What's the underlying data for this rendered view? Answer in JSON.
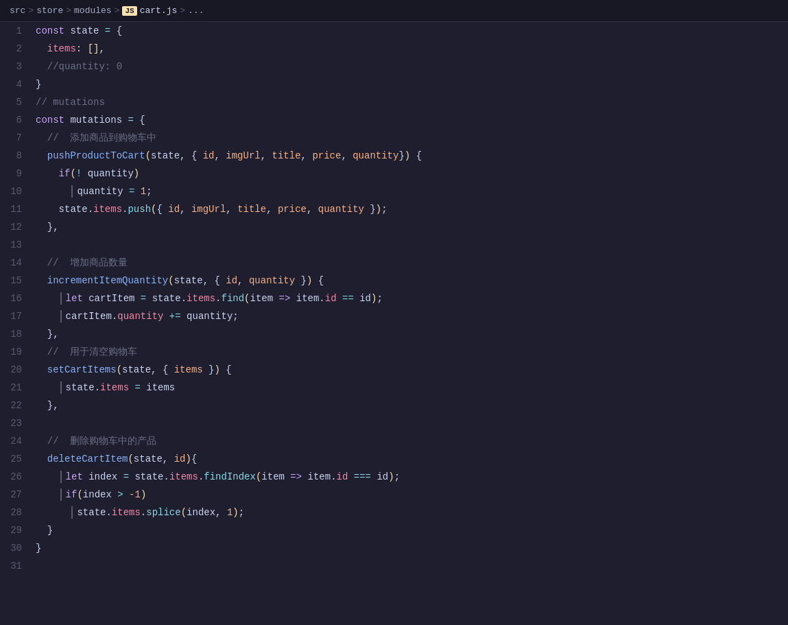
{
  "breadcrumb": {
    "src": "src",
    "sep1": ">",
    "store": "store",
    "sep2": ">",
    "modules": "modules",
    "sep3": ">",
    "js_badge": "JS",
    "filename": "cart.js",
    "sep4": ">",
    "ellipsis": "..."
  },
  "lines": [
    {
      "num": 1,
      "tokens": [
        {
          "t": "kw",
          "v": "const "
        },
        {
          "t": "ident",
          "v": "state "
        },
        {
          "t": "op",
          "v": "= "
        },
        {
          "t": "brace",
          "v": "{"
        }
      ]
    },
    {
      "num": 2,
      "tokens": [
        {
          "t": "indent",
          "v": "  "
        },
        {
          "t": "prop",
          "v": "items"
        },
        {
          "t": "punct",
          "v": ": "
        },
        {
          "t": "bracket",
          "v": "[]"
        },
        {
          "t": "punct",
          "v": ","
        }
      ]
    },
    {
      "num": 3,
      "tokens": [
        {
          "t": "indent",
          "v": "  "
        },
        {
          "t": "comment",
          "v": "//quantity: 0"
        }
      ]
    },
    {
      "num": 4,
      "tokens": [
        {
          "t": "brace",
          "v": "}"
        }
      ]
    },
    {
      "num": 5,
      "tokens": [
        {
          "t": "comment",
          "v": "// mutations"
        }
      ]
    },
    {
      "num": 6,
      "tokens": [
        {
          "t": "kw",
          "v": "const "
        },
        {
          "t": "ident",
          "v": "mutations "
        },
        {
          "t": "op",
          "v": "= "
        },
        {
          "t": "brace",
          "v": "{"
        }
      ]
    },
    {
      "num": 7,
      "tokens": [
        {
          "t": "indent",
          "v": "  "
        },
        {
          "t": "comment",
          "v": "//  添加商品到购物车中"
        }
      ]
    },
    {
      "num": 8,
      "tokens": [
        {
          "t": "indent",
          "v": "  "
        },
        {
          "t": "fn-name",
          "v": "pushProductToCart"
        },
        {
          "t": "paren",
          "v": "("
        },
        {
          "t": "ident",
          "v": "state"
        },
        {
          "t": "punct",
          "v": ", "
        },
        {
          "t": "brace",
          "v": "{ "
        },
        {
          "t": "param",
          "v": "id"
        },
        {
          "t": "punct",
          "v": ", "
        },
        {
          "t": "param",
          "v": "imgUrl"
        },
        {
          "t": "punct",
          "v": ", "
        },
        {
          "t": "param",
          "v": "title"
        },
        {
          "t": "punct",
          "v": ", "
        },
        {
          "t": "param",
          "v": "price"
        },
        {
          "t": "punct",
          "v": ", "
        },
        {
          "t": "param",
          "v": "quantity"
        },
        {
          "t": "brace",
          "v": "}"
        },
        {
          "t": "paren",
          "v": ")"
        },
        {
          "t": "brace",
          "v": " {"
        }
      ]
    },
    {
      "num": 9,
      "tokens": [
        {
          "t": "indent",
          "v": "    "
        },
        {
          "t": "kw",
          "v": "if"
        },
        {
          "t": "paren",
          "v": "("
        },
        {
          "t": "op",
          "v": "! "
        },
        {
          "t": "ident",
          "v": "quantity"
        },
        {
          "t": "paren",
          "v": ")"
        }
      ]
    },
    {
      "num": 10,
      "tokens": [
        {
          "t": "indent",
          "v": "      "
        },
        {
          "t": "vbar",
          "v": ""
        },
        {
          "t": "ident",
          "v": "quantity "
        },
        {
          "t": "op",
          "v": "= "
        },
        {
          "t": "num",
          "v": "1"
        },
        {
          "t": "punct",
          "v": ";"
        }
      ]
    },
    {
      "num": 11,
      "tokens": [
        {
          "t": "indent",
          "v": "    "
        },
        {
          "t": "ident",
          "v": "state"
        },
        {
          "t": "punct",
          "v": "."
        },
        {
          "t": "prop",
          "v": "items"
        },
        {
          "t": "punct",
          "v": "."
        },
        {
          "t": "method",
          "v": "push"
        },
        {
          "t": "paren",
          "v": "("
        },
        {
          "t": "brace",
          "v": "{ "
        },
        {
          "t": "param",
          "v": "id"
        },
        {
          "t": "punct",
          "v": ", "
        },
        {
          "t": "param",
          "v": "imgUrl"
        },
        {
          "t": "punct",
          "v": ", "
        },
        {
          "t": "param",
          "v": "title"
        },
        {
          "t": "punct",
          "v": ", "
        },
        {
          "t": "param",
          "v": "price"
        },
        {
          "t": "punct",
          "v": ", "
        },
        {
          "t": "param",
          "v": "quantity"
        },
        {
          "t": "brace",
          "v": " }"
        },
        {
          "t": "paren",
          "v": ")"
        },
        {
          "t": "punct",
          "v": ";"
        }
      ]
    },
    {
      "num": 12,
      "tokens": [
        {
          "t": "indent",
          "v": "  "
        },
        {
          "t": "brace",
          "v": "},"
        }
      ]
    },
    {
      "num": 13,
      "tokens": []
    },
    {
      "num": 14,
      "tokens": [
        {
          "t": "indent",
          "v": "  "
        },
        {
          "t": "comment",
          "v": "//  增加商品数量"
        }
      ]
    },
    {
      "num": 15,
      "tokens": [
        {
          "t": "indent",
          "v": "  "
        },
        {
          "t": "fn-name",
          "v": "incrementItemQuantity"
        },
        {
          "t": "paren",
          "v": "("
        },
        {
          "t": "ident",
          "v": "state"
        },
        {
          "t": "punct",
          "v": ", "
        },
        {
          "t": "brace",
          "v": "{ "
        },
        {
          "t": "param",
          "v": "id"
        },
        {
          "t": "punct",
          "v": ", "
        },
        {
          "t": "param",
          "v": "quantity"
        },
        {
          "t": "brace",
          "v": " }"
        },
        {
          "t": "paren",
          "v": ")"
        },
        {
          "t": "brace",
          "v": " {"
        }
      ]
    },
    {
      "num": 16,
      "tokens": [
        {
          "t": "indent",
          "v": "    "
        },
        {
          "t": "vbar",
          "v": ""
        },
        {
          "t": "kw",
          "v": "let "
        },
        {
          "t": "ident",
          "v": "cartItem "
        },
        {
          "t": "op",
          "v": "= "
        },
        {
          "t": "ident",
          "v": "state"
        },
        {
          "t": "punct",
          "v": "."
        },
        {
          "t": "prop",
          "v": "items"
        },
        {
          "t": "punct",
          "v": "."
        },
        {
          "t": "method",
          "v": "find"
        },
        {
          "t": "paren",
          "v": "("
        },
        {
          "t": "ident",
          "v": "item "
        },
        {
          "t": "arrow",
          "v": "=> "
        },
        {
          "t": "ident",
          "v": "item"
        },
        {
          "t": "punct",
          "v": "."
        },
        {
          "t": "prop",
          "v": "id "
        },
        {
          "t": "op",
          "v": "== "
        },
        {
          "t": "ident",
          "v": "id"
        },
        {
          "t": "paren",
          "v": ")"
        },
        {
          "t": "punct",
          "v": ";"
        }
      ]
    },
    {
      "num": 17,
      "tokens": [
        {
          "t": "indent",
          "v": "    "
        },
        {
          "t": "vbar",
          "v": ""
        },
        {
          "t": "ident",
          "v": "cartItem"
        },
        {
          "t": "punct",
          "v": "."
        },
        {
          "t": "prop",
          "v": "quantity "
        },
        {
          "t": "op",
          "v": "+= "
        },
        {
          "t": "ident",
          "v": "quantity"
        },
        {
          "t": "punct",
          "v": ";"
        }
      ]
    },
    {
      "num": 18,
      "tokens": [
        {
          "t": "indent",
          "v": "  "
        },
        {
          "t": "brace",
          "v": "},"
        }
      ]
    },
    {
      "num": 19,
      "tokens": [
        {
          "t": "indent",
          "v": "  "
        },
        {
          "t": "comment",
          "v": "//  用于清空购物车"
        }
      ]
    },
    {
      "num": 20,
      "tokens": [
        {
          "t": "indent",
          "v": "  "
        },
        {
          "t": "fn-name",
          "v": "setCartItems"
        },
        {
          "t": "paren",
          "v": "("
        },
        {
          "t": "ident",
          "v": "state"
        },
        {
          "t": "punct",
          "v": ", "
        },
        {
          "t": "brace",
          "v": "{ "
        },
        {
          "t": "param",
          "v": "items"
        },
        {
          "t": "brace",
          "v": " }"
        },
        {
          "t": "paren",
          "v": ")"
        },
        {
          "t": "brace",
          "v": " {"
        }
      ]
    },
    {
      "num": 21,
      "tokens": [
        {
          "t": "indent",
          "v": "    "
        },
        {
          "t": "vbar",
          "v": ""
        },
        {
          "t": "ident",
          "v": "state"
        },
        {
          "t": "punct",
          "v": "."
        },
        {
          "t": "prop",
          "v": "items "
        },
        {
          "t": "op",
          "v": "= "
        },
        {
          "t": "ident",
          "v": "items"
        }
      ]
    },
    {
      "num": 22,
      "tokens": [
        {
          "t": "indent",
          "v": "  "
        },
        {
          "t": "brace",
          "v": "},"
        }
      ]
    },
    {
      "num": 23,
      "tokens": []
    },
    {
      "num": 24,
      "tokens": [
        {
          "t": "indent",
          "v": "  "
        },
        {
          "t": "comment",
          "v": "//  删除购物车中的产品"
        }
      ]
    },
    {
      "num": 25,
      "tokens": [
        {
          "t": "indent",
          "v": "  "
        },
        {
          "t": "fn-name",
          "v": "deleteCartItem"
        },
        {
          "t": "paren",
          "v": "("
        },
        {
          "t": "ident",
          "v": "state"
        },
        {
          "t": "punct",
          "v": ", "
        },
        {
          "t": "param",
          "v": "id"
        },
        {
          "t": "paren",
          "v": ")"
        },
        {
          "t": "brace",
          "v": "{"
        }
      ]
    },
    {
      "num": 26,
      "tokens": [
        {
          "t": "indent",
          "v": "    "
        },
        {
          "t": "vbar",
          "v": ""
        },
        {
          "t": "kw",
          "v": "let "
        },
        {
          "t": "ident",
          "v": "index "
        },
        {
          "t": "op",
          "v": "= "
        },
        {
          "t": "ident",
          "v": "state"
        },
        {
          "t": "punct",
          "v": "."
        },
        {
          "t": "prop",
          "v": "items"
        },
        {
          "t": "punct",
          "v": "."
        },
        {
          "t": "method",
          "v": "findIndex"
        },
        {
          "t": "paren",
          "v": "("
        },
        {
          "t": "ident",
          "v": "item "
        },
        {
          "t": "arrow",
          "v": "=> "
        },
        {
          "t": "ident",
          "v": "item"
        },
        {
          "t": "punct",
          "v": "."
        },
        {
          "t": "prop",
          "v": "id "
        },
        {
          "t": "op",
          "v": "=== "
        },
        {
          "t": "ident",
          "v": "id"
        },
        {
          "t": "paren",
          "v": ")"
        },
        {
          "t": "punct",
          "v": ";"
        }
      ]
    },
    {
      "num": 27,
      "tokens": [
        {
          "t": "indent",
          "v": "    "
        },
        {
          "t": "vbar",
          "v": ""
        },
        {
          "t": "kw",
          "v": "if"
        },
        {
          "t": "paren",
          "v": "("
        },
        {
          "t": "ident",
          "v": "index "
        },
        {
          "t": "op",
          "v": "> "
        },
        {
          "t": "num",
          "v": "-1"
        },
        {
          "t": "paren",
          "v": ")"
        }
      ]
    },
    {
      "num": 28,
      "tokens": [
        {
          "t": "indent",
          "v": "      "
        },
        {
          "t": "vbar2",
          "v": ""
        },
        {
          "t": "ident",
          "v": "state"
        },
        {
          "t": "punct",
          "v": "."
        },
        {
          "t": "prop",
          "v": "items"
        },
        {
          "t": "punct",
          "v": "."
        },
        {
          "t": "method",
          "v": "splice"
        },
        {
          "t": "paren",
          "v": "("
        },
        {
          "t": "ident",
          "v": "index"
        },
        {
          "t": "punct",
          "v": ", "
        },
        {
          "t": "num",
          "v": "1"
        },
        {
          "t": "paren",
          "v": ")"
        },
        {
          "t": "punct",
          "v": ";"
        }
      ]
    },
    {
      "num": 29,
      "tokens": [
        {
          "t": "indent",
          "v": "  "
        },
        {
          "t": "brace",
          "v": "}"
        }
      ]
    },
    {
      "num": 30,
      "tokens": [
        {
          "t": "brace",
          "v": "}"
        }
      ]
    },
    {
      "num": 31,
      "tokens": []
    }
  ]
}
